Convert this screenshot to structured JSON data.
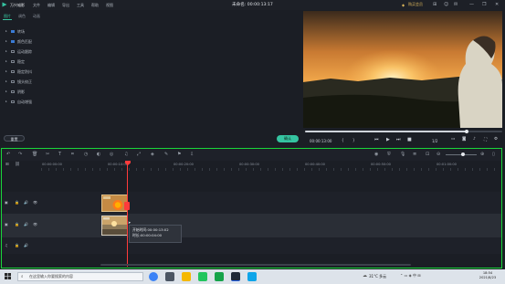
{
  "app": {
    "title": "万兴喵影",
    "project_name": "未命名: 00:00:13:17",
    "member": "购买会员"
  },
  "menu": [
    "文件",
    "编辑",
    "导出",
    "工具",
    "帮助",
    "视图"
  ],
  "window_controls": [
    "—",
    "❐",
    "✕"
  ],
  "panel": {
    "tabs": [
      "图片",
      "调色",
      "动画"
    ],
    "options": [
      {
        "label": "转场",
        "checked": true
      },
      {
        "label": "颜色匹配",
        "checked": true
      },
      {
        "label": "运动跟踪",
        "checked": false
      },
      {
        "label": "稳定",
        "checked": false
      },
      {
        "label": "稳定防抖",
        "checked": false
      },
      {
        "label": "镜头校正",
        "checked": false
      },
      {
        "label": "阴影",
        "checked": false
      },
      {
        "label": "自动增强",
        "checked": false
      }
    ],
    "reset_label": "重置",
    "ok_label": "确认"
  },
  "player": {
    "timecode": "00:00:13:00",
    "ratio": "1/2",
    "progress": 0.82,
    "sky_color": "#f0a64a",
    "ground_color": "#1c1f18"
  },
  "timeline": {
    "ruler_labels": [
      "00:00:00:00",
      "00:00:10:00",
      "00:00:20:00",
      "00:00:30:00",
      "00:00:40:00",
      "00:00:50:00",
      "00:01:00:00"
    ],
    "tooltip_lines": [
      "开始时间:00:00:13:02",
      "时长:00:00:04:00"
    ],
    "playhead_color": "#ff3b3b",
    "highlight_color": "#19d63a"
  },
  "taskbar": {
    "search_placeholder": "在这里输入你要搜索的内容",
    "weather": "31°C 多云",
    "time": "18:54",
    "date": "2021/8/23"
  }
}
